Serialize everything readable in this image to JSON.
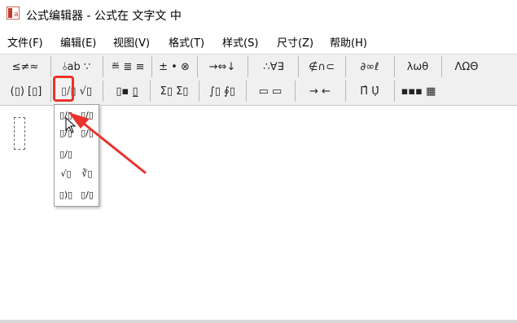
{
  "window": {
    "title": "公式编辑器 - 公式在 文字文 中"
  },
  "menu": [
    "文件(F)",
    "编辑(E)",
    "视图(V)",
    "格式(T)",
    "样式(S)",
    "尺寸(Z)",
    "帮助(H)"
  ],
  "toolbar_row1": [
    {
      "label": "≤≠≈",
      "icon": "relational-symbols-icon"
    },
    {
      "label": "⫰ab ∵",
      "icon": "spaces-ellipses-icon"
    },
    {
      "label": "≝ ≣ ≡",
      "icon": "embellishments-icon"
    },
    {
      "label": "± • ⊗",
      "icon": "operator-symbols-icon"
    },
    {
      "label": "→⇔↓",
      "icon": "arrow-symbols-icon"
    },
    {
      "label": "∴∀∃",
      "icon": "logical-symbols-icon"
    },
    {
      "label": "∉∩⊂",
      "icon": "set-theory-symbols-icon"
    },
    {
      "label": "∂∞ℓ",
      "icon": "misc-symbols-icon"
    },
    {
      "label": "λωθ",
      "icon": "greek-lowercase-icon"
    },
    {
      "label": "ΛΩΘ",
      "icon": "greek-uppercase-icon"
    }
  ],
  "toolbar_row2": [
    {
      "label": "(▯) [▯]",
      "icon": "fence-templates-icon"
    },
    {
      "label": "▯/▯ √▯",
      "icon": "fraction-radical-templates-icon"
    },
    {
      "label": "▯▪ ▯̲",
      "icon": "subscript-superscript-templates-icon"
    },
    {
      "label": "Σ▯ Σ▯",
      "icon": "summation-templates-icon"
    },
    {
      "label": "∫▯ ∮▯",
      "icon": "integral-templates-icon"
    },
    {
      "label": "▭ ▭",
      "icon": "underbar-overbar-templates-icon"
    },
    {
      "label": "→ ←",
      "icon": "labeled-arrow-templates-icon"
    },
    {
      "label": "Π̂ Ụ̇",
      "icon": "products-set-theory-templates-icon"
    },
    {
      "label": "▪▪▪ ▦",
      "icon": "matrix-templates-icon"
    }
  ],
  "popup_items": [
    "▯/▯",
    "▯/▯",
    "▯/▯",
    "▯/▯",
    "▯/▯",
    "√▯",
    "∛▯",
    "▯)▯",
    "▯/▯"
  ],
  "colors": {
    "highlight": "#e8342c",
    "toolbar": "#f0f0f0"
  }
}
